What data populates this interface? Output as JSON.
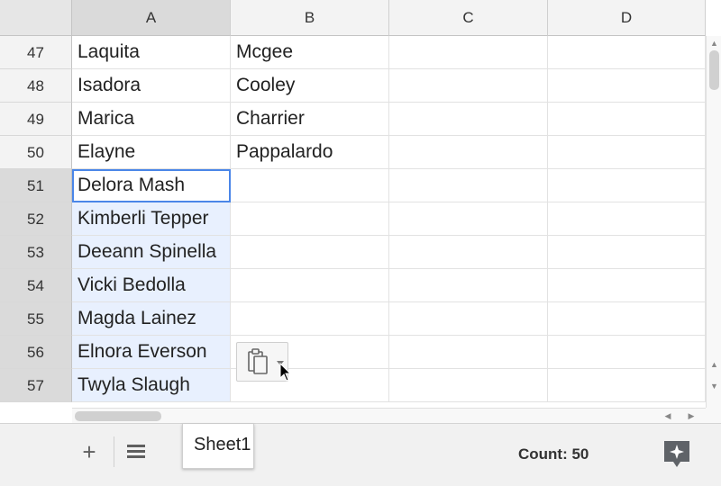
{
  "columns": [
    {
      "label": "",
      "highlighted": false
    },
    {
      "label": "A",
      "highlighted": true
    },
    {
      "label": "B",
      "highlighted": false
    },
    {
      "label": "C",
      "highlighted": false
    },
    {
      "label": "D",
      "highlighted": false
    }
  ],
  "rows": [
    {
      "number": "47",
      "a": "Laquita",
      "b": "Mcgee",
      "selected": false,
      "active": false
    },
    {
      "number": "48",
      "a": "Isadora",
      "b": "Cooley",
      "selected": false,
      "active": false
    },
    {
      "number": "49",
      "a": "Marica",
      "b": "Charrier",
      "selected": false,
      "active": false
    },
    {
      "number": "50",
      "a": "Elayne",
      "b": "Pappalardo",
      "selected": false,
      "active": false
    },
    {
      "number": "51",
      "a": "Delora Mash",
      "b": "",
      "selected": true,
      "active": true
    },
    {
      "number": "52",
      "a": "Kimberli Tepper",
      "b": "",
      "selected": true,
      "active": false
    },
    {
      "number": "53",
      "a": "Deeann Spinella",
      "b": "",
      "selected": true,
      "active": false
    },
    {
      "number": "54",
      "a": "Vicki Bedolla",
      "b": "",
      "selected": true,
      "active": false
    },
    {
      "number": "55",
      "a": "Magda Lainez",
      "b": "",
      "selected": true,
      "active": false
    },
    {
      "number": "56",
      "a": "Elnora Everson",
      "b": "",
      "selected": true,
      "active": false
    },
    {
      "number": "57",
      "a": "Twyla Slaugh",
      "b": "",
      "selected": true,
      "active": false
    }
  ],
  "footer": {
    "add_sheet_icon": "plus-icon",
    "sheet_list_icon": "menu-icon",
    "sheet_tab": "Sheet1",
    "count": "Count: 50",
    "explore_icon": "explore-icon"
  },
  "paste_button": {
    "icon": "clipboard-icon"
  },
  "colors": {
    "selection": "#e8f0fe",
    "active_border": "#4a86e8",
    "header_bg": "#f3f3f3",
    "header_highlight": "#dadada",
    "explore": "#5f6368"
  }
}
